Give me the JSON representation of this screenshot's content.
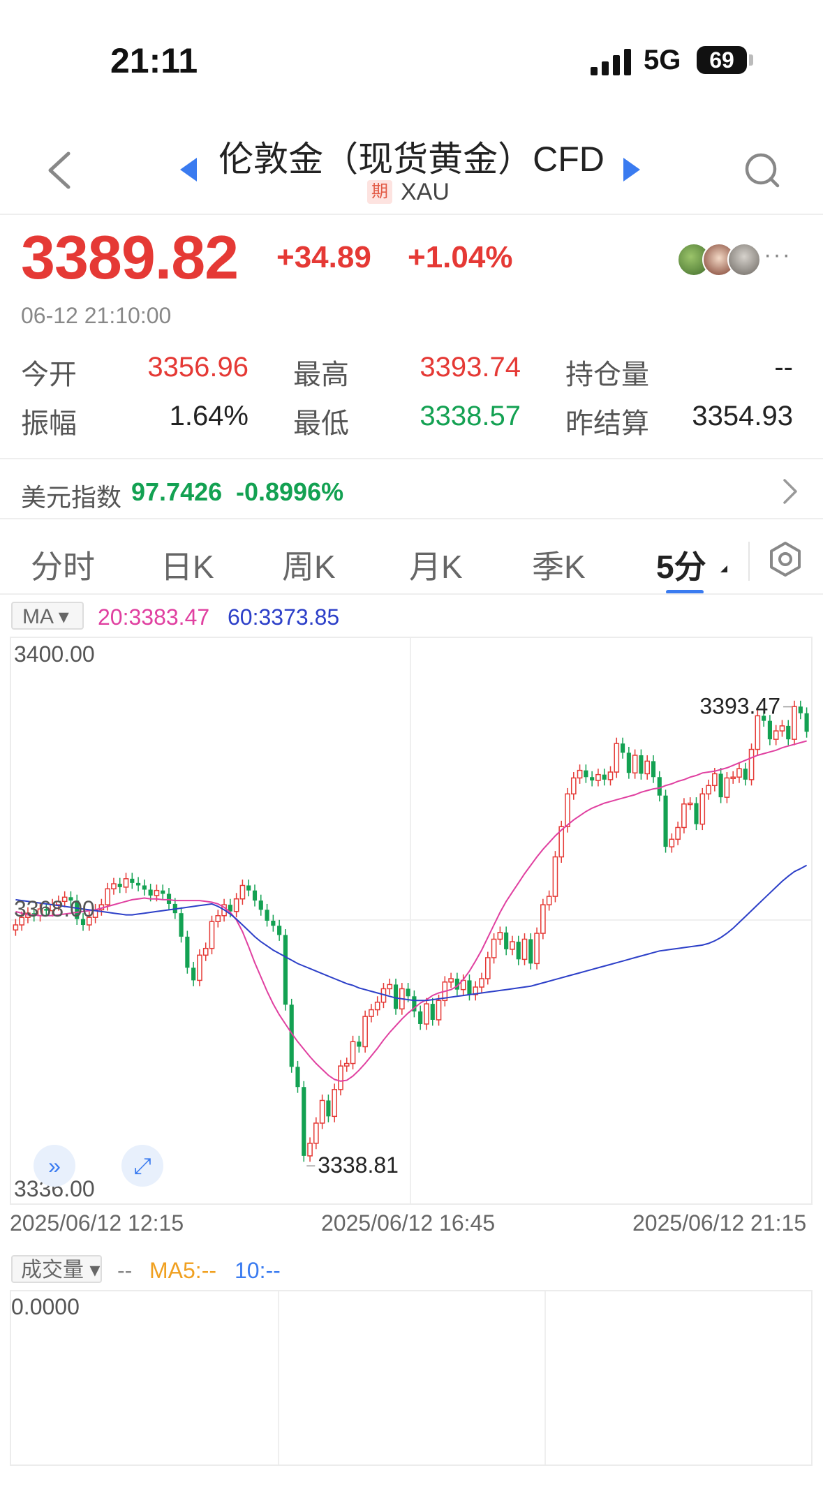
{
  "status_bar": {
    "time": "21:11",
    "network": "5G",
    "battery": "69"
  },
  "header": {
    "title": "伦敦金（现货黄金）CFD",
    "badge": "期",
    "code": "XAU"
  },
  "quote": {
    "price": "3389.82",
    "change": "+34.89",
    "change_pct": "+1.04%",
    "timestamp": "06-12 21:10:00",
    "more": "···",
    "stats": [
      {
        "label": "今开",
        "value": "3356.96",
        "color": "red"
      },
      {
        "label": "最高",
        "value": "3393.74",
        "color": "red"
      },
      {
        "label": "持仓量",
        "value": "--",
        "color": "black"
      },
      {
        "label": "振幅",
        "value": "1.64%",
        "color": "black"
      },
      {
        "label": "最低",
        "value": "3338.57",
        "color": "green"
      },
      {
        "label": "昨结算",
        "value": "3354.93",
        "color": "black"
      }
    ]
  },
  "index": {
    "label": "美元指数",
    "value": "97.7426",
    "change": "-0.8996%"
  },
  "tabs": [
    "分时",
    "日K",
    "周K",
    "月K",
    "季K",
    "5分"
  ],
  "active_tab": "5分",
  "indicator": {
    "name": "MA",
    "ma20": "20:3383.47",
    "ma60": "60:3373.85"
  },
  "colors": {
    "up": "#e53935",
    "down": "#13a152",
    "accent": "#3a7bf0",
    "ma20": "#e040a0",
    "ma60": "#2c3fc8"
  },
  "chart_data": {
    "type": "candlestick",
    "interval": "5分",
    "y_axis_labels": [
      "3400.00",
      "3368.00",
      "3336.00"
    ],
    "ylim": [
      3336.0,
      3400.0
    ],
    "x_axis_labels": [
      "2025/06/12 12:15",
      "2025/06/12 16:45",
      "2025/06/12 21:15"
    ],
    "annotations": {
      "high": "3393.47",
      "low": "3338.81"
    },
    "closes": [
      3367.5,
      3368.4,
      3368.9,
      3368.6,
      3369.4,
      3369.2,
      3369.9,
      3370.3,
      3370.8,
      3370.4,
      3368.2,
      3367.5,
      3368.4,
      3369.3,
      3369.9,
      3371.8,
      3372.4,
      3372.0,
      3373.0,
      3372.5,
      3372.2,
      3371.7,
      3371.0,
      3371.6,
      3371.2,
      3370.0,
      3368.9,
      3366.1,
      3362.4,
      3360.9,
      3363.9,
      3364.7,
      3367.9,
      3368.6,
      3369.9,
      3369.1,
      3370.6,
      3372.2,
      3371.6,
      3370.4,
      3369.3,
      3368.0,
      3367.4,
      3366.3,
      3358.0,
      3350.6,
      3348.2,
      3340.0,
      3341.5,
      3343.9,
      3346.6,
      3344.7,
      3347.9,
      3350.7,
      3351.0,
      3353.6,
      3353.0,
      3356.6,
      3357.4,
      3358.3,
      3359.9,
      3360.4,
      3357.5,
      3359.9,
      3359.0,
      3357.2,
      3355.7,
      3358.1,
      3356.2,
      3358.5,
      3360.7,
      3361.1,
      3359.8,
      3360.9,
      3359.2,
      3360.1,
      3361.1,
      3363.6,
      3365.8,
      3366.6,
      3364.6,
      3365.5,
      3363.4,
      3365.8,
      3362.9,
      3366.5,
      3369.9,
      3370.9,
      3375.6,
      3379.2,
      3383.1,
      3385.0,
      3385.9,
      3385.1,
      3384.7,
      3385.4,
      3384.8,
      3385.7,
      3389.1,
      3388.0,
      3385.6,
      3387.7,
      3385.5,
      3387.0,
      3385.1,
      3382.9,
      3376.8,
      3377.7,
      3379.1,
      3381.9,
      3382.0,
      3379.5,
      3383.1,
      3384.1,
      3385.5,
      3382.7,
      3385.0,
      3385.1,
      3386.1,
      3384.8,
      3388.4,
      3392.4,
      3391.8,
      3389.6,
      3390.6,
      3391.2,
      3389.6,
      3393.5,
      3392.7,
      3390.5
    ],
    "ma20": [
      3369.1,
      3368.9,
      3368.7,
      3368.7,
      3368.6,
      3368.6,
      3368.6,
      3368.7,
      3368.8,
      3368.9,
      3369.0,
      3369.1,
      3369.2,
      3369.3,
      3369.5,
      3369.7,
      3369.9,
      3370.1,
      3370.3,
      3370.5,
      3370.6,
      3370.7,
      3370.6,
      3370.6,
      3370.5,
      3370.5,
      3370.4,
      3370.4,
      3370.4,
      3370.4,
      3370.4,
      3370.3,
      3370.2,
      3370.0,
      3369.6,
      3369.0,
      3368.1,
      3366.7,
      3364.9,
      3363.0,
      3361.3,
      3359.6,
      3358.1,
      3356.8,
      3355.7,
      3354.6,
      3353.6,
      3352.7,
      3351.8,
      3351.0,
      3350.3,
      3349.6,
      3349.1,
      3348.9,
      3349.0,
      3349.5,
      3350.2,
      3351.0,
      3351.9,
      3352.8,
      3353.8,
      3354.7,
      3355.5,
      3356.3,
      3357.0,
      3357.6,
      3358.2,
      3358.6,
      3359.1,
      3359.4,
      3359.6,
      3359.8,
      3360.2,
      3361.0,
      3362.0,
      3363.2,
      3364.5,
      3366.0,
      3367.5,
      3369.0,
      3370.3,
      3371.4,
      3372.5,
      3373.6,
      3374.6,
      3375.6,
      3376.5,
      3377.3,
      3378.1,
      3378.8,
      3379.4,
      3380.0,
      3380.5,
      3381.0,
      3381.4,
      3381.7,
      3382.0,
      3382.2,
      3382.4,
      3382.6,
      3382.8,
      3383.0,
      3383.3,
      3383.5,
      3383.7,
      3383.8,
      3384.1,
      3384.3,
      3384.6,
      3384.8,
      3385.1,
      3385.3,
      3385.6,
      3385.7,
      3385.8,
      3386.0,
      3386.2,
      3386.5,
      3386.8,
      3387.1,
      3387.4,
      3387.7,
      3387.9,
      3388.1,
      3388.3,
      3388.6,
      3388.8,
      3389.0,
      3389.2,
      3389.4
    ],
    "ma60": [
      3370.5,
      3370.4,
      3370.3,
      3370.2,
      3370.1,
      3370.0,
      3369.9,
      3369.8,
      3369.7,
      3369.6,
      3369.5,
      3369.4,
      3369.3,
      3369.2,
      3369.1,
      3369.0,
      3368.9,
      3368.8,
      3368.7,
      3368.7,
      3368.8,
      3368.9,
      3369.0,
      3369.1,
      3369.2,
      3369.3,
      3369.4,
      3369.5,
      3369.6,
      3369.7,
      3369.8,
      3369.9,
      3370.0,
      3369.7,
      3369.3,
      3368.8,
      3368.2,
      3367.5,
      3366.8,
      3366.1,
      3365.5,
      3365.0,
      3364.5,
      3364.1,
      3363.7,
      3363.3,
      3362.9,
      3362.6,
      3362.3,
      3362.0,
      3361.7,
      3361.4,
      3361.1,
      3360.8,
      3360.5,
      3360.3,
      3360.0,
      3359.8,
      3359.6,
      3359.4,
      3359.2,
      3359.0,
      3358.8,
      3358.7,
      3358.6,
      3358.5,
      3358.5,
      3358.5,
      3358.6,
      3358.7,
      3358.8,
      3358.9,
      3359.0,
      3359.1,
      3359.2,
      3359.3,
      3359.4,
      3359.5,
      3359.6,
      3359.7,
      3359.8,
      3359.9,
      3360.0,
      3360.1,
      3360.2,
      3360.4,
      3360.6,
      3360.8,
      3361.0,
      3361.2,
      3361.4,
      3361.6,
      3361.8,
      3362.0,
      3362.2,
      3362.4,
      3362.6,
      3362.8,
      3363.0,
      3363.2,
      3363.4,
      3363.6,
      3363.8,
      3364.0,
      3364.2,
      3364.4,
      3364.5,
      3364.6,
      3364.7,
      3364.8,
      3364.9,
      3365.0,
      3365.1,
      3365.3,
      3365.6,
      3366.0,
      3366.5,
      3367.1,
      3367.8,
      3368.5,
      3369.2,
      3369.9,
      3370.6,
      3371.3,
      3372.0,
      3372.7,
      3373.3,
      3373.85,
      3374.2,
      3374.6
    ]
  },
  "volume": {
    "label": "成交量",
    "dash": "--",
    "ma5": "MA5:--",
    "ma10": "10:--",
    "zero": "0.0000"
  }
}
